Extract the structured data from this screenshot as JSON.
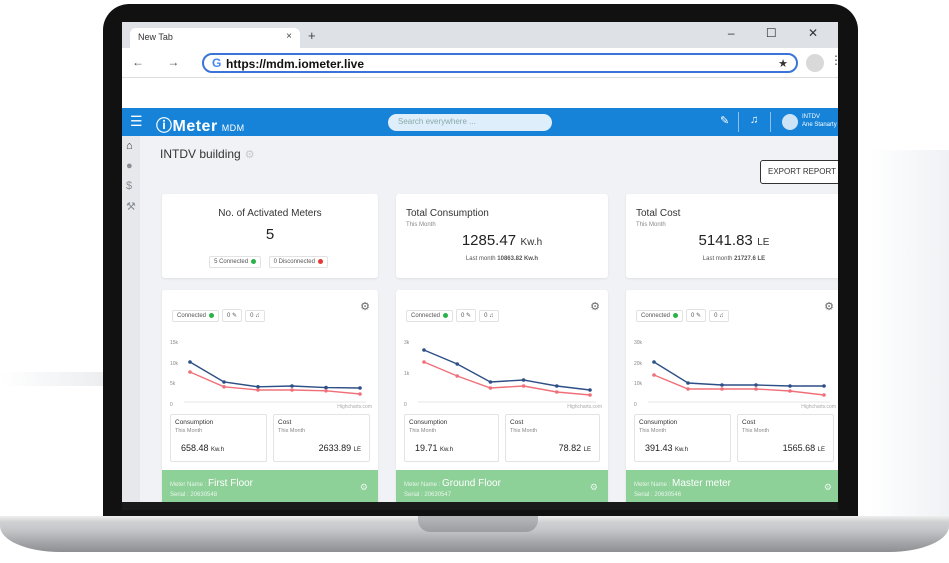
{
  "browser": {
    "tab_title": "New Tab",
    "tab_close": "×",
    "new_tab": "+",
    "window_controls": "– ☐ ✕",
    "nav_buttons": "← → C",
    "url": "https://mdm.iometer.live",
    "google_icon": "G",
    "bookmark_icon": "★",
    "menu_icon": "⋮"
  },
  "app": {
    "logo": "ⓘMeter",
    "logo_suffix": "MDM",
    "search_placeholder": "Search everywhere ...",
    "user_name": "INTDV",
    "user_role": "Ane Stanarty",
    "page_title": "INTDV building",
    "export_label": "EXPORT REPORT"
  },
  "summary": {
    "activated": {
      "title": "No. of Activated Meters",
      "value": "5",
      "connected": "5 Connected",
      "disconnected": "0 Disconnected"
    },
    "consumption": {
      "title": "Total Consumption",
      "sub": "This Month",
      "value": "1285.47",
      "unit": "Kw.h",
      "last": "Last month",
      "last_value": "10863.82 Kw.h"
    },
    "cost": {
      "title": "Total Cost",
      "sub": "This Month",
      "value": "5141.83",
      "unit": "LE",
      "last": "Last month",
      "last_value": "21727.6 LE"
    }
  },
  "colors": {
    "connected": "#2bb34a",
    "disconnected": "#e53935",
    "line_blue": "#2d4f86",
    "line_red": "#f0707a",
    "accent": "#1683d8",
    "meter_green": "#8dd098"
  },
  "meters": [
    {
      "status": "Connected",
      "pill2": "0",
      "pill3": "0",
      "yticks": [
        "15k",
        "10k",
        "5k",
        "0"
      ],
      "credit": "Highcharts.com",
      "consumption_label": "Consumption",
      "consumption_sub": "This Month",
      "consumption_value": "658.48",
      "consumption_unit": "Kw.h",
      "cost_label": "Cost",
      "cost_sub": "This Month",
      "cost_value": "2633.89",
      "cost_unit": "LE",
      "name_label": "Meter Name :",
      "name": "First Floor",
      "serial": "Serial : 20630548"
    },
    {
      "status": "Connected",
      "pill2": "0",
      "pill3": "0",
      "yticks": [
        "3k",
        "1k",
        "0"
      ],
      "credit": "Highcharts.com",
      "consumption_label": "Consumption",
      "consumption_sub": "This Month",
      "consumption_value": "19.71",
      "consumption_unit": "Kw.h",
      "cost_label": "Cost",
      "cost_sub": "This Month",
      "cost_value": "78.82",
      "cost_unit": "LE",
      "name_label": "Meter Name :",
      "name": "Ground Floor",
      "serial": "Serial : 20630547"
    },
    {
      "status": "Connected",
      "pill2": "0",
      "pill3": "0",
      "yticks": [
        "30k",
        "20k",
        "10k",
        "0"
      ],
      "credit": "Highcharts.com",
      "consumption_label": "Consumption",
      "consumption_sub": "This Month",
      "consumption_value": "391.43",
      "consumption_unit": "Kw.h",
      "cost_label": "Cost",
      "cost_sub": "This Month",
      "cost_value": "1565.68",
      "cost_unit": "LE",
      "name_label": "Meter Name :",
      "name": "Master meter",
      "serial": "Serial : 20630546"
    }
  ],
  "chart_data": [
    {
      "type": "line",
      "series": [
        {
          "values": [
            10000,
            5000,
            3800,
            4000,
            3600,
            3500
          ]
        },
        {
          "values": [
            7500,
            3800,
            3000,
            3000,
            2800,
            2000
          ]
        }
      ],
      "ylim": [
        0,
        15000
      ]
    },
    {
      "type": "line",
      "series": [
        {
          "values": [
            2600,
            1900,
            1000,
            1100,
            800,
            600
          ]
        },
        {
          "values": [
            2000,
            1300,
            700,
            800,
            500,
            350
          ]
        }
      ],
      "ylim": [
        0,
        3000
      ]
    },
    {
      "type": "line",
      "series": [
        {
          "values": [
            20000,
            9500,
            8500,
            8500,
            8000,
            8000
          ]
        },
        {
          "values": [
            13500,
            6500,
            6500,
            6500,
            5500,
            3500
          ]
        }
      ],
      "ylim": [
        0,
        30000
      ]
    }
  ]
}
